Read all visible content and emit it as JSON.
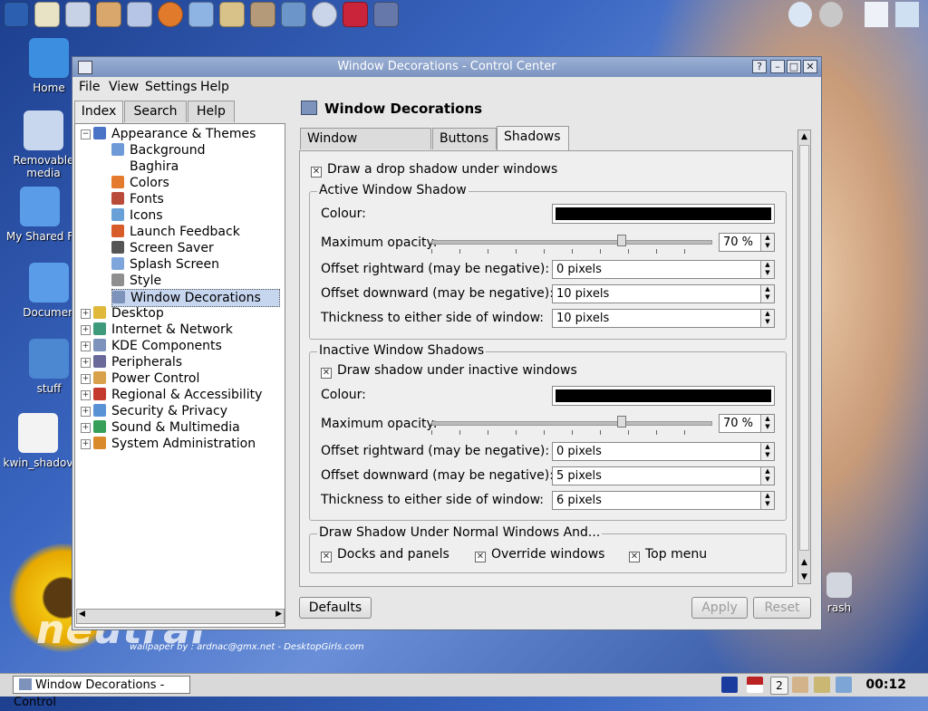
{
  "desktop": {
    "icons": [
      {
        "label": "Home"
      },
      {
        "label": "Removable media"
      },
      {
        "label": "My Shared F"
      },
      {
        "label": "Documen"
      },
      {
        "label": "stuff"
      },
      {
        "label": "kwin_shadov"
      },
      {
        "label": "rash"
      }
    ],
    "wallpaper_credit": "wallpaper by : ardnac@gmx.net - DesktopGirls.com"
  },
  "window": {
    "title": "Window Decorations - Control Center",
    "buttons": {
      "help": "?",
      "minimize": "–",
      "maximize": "□",
      "close": "✕"
    },
    "menu": [
      "File",
      "View",
      "Settings",
      "Help"
    ]
  },
  "sidebar": {
    "tabs": [
      "Index",
      "Search",
      "Help"
    ],
    "tree": [
      {
        "label": "Appearance & Themes",
        "icon": "appearance-icon",
        "expanded": true
      },
      {
        "label": "Background",
        "icon": "background-icon"
      },
      {
        "label": "Baghira",
        "icon": ""
      },
      {
        "label": "Colors",
        "icon": "colors-icon"
      },
      {
        "label": "Fonts",
        "icon": "fonts-icon"
      },
      {
        "label": "Icons",
        "icon": "icons-icon"
      },
      {
        "label": "Launch Feedback",
        "icon": "launch-feedback-icon"
      },
      {
        "label": "Screen Saver",
        "icon": "screen-saver-icon"
      },
      {
        "label": "Splash Screen",
        "icon": "splash-screen-icon"
      },
      {
        "label": "Style",
        "icon": "style-icon"
      },
      {
        "label": "Window Decorations",
        "icon": "window-decorations-icon",
        "selected": true
      },
      {
        "label": "Desktop",
        "icon": "desktop-icon"
      },
      {
        "label": "Internet & Network",
        "icon": "internet-icon"
      },
      {
        "label": "KDE Components",
        "icon": "kde-components-icon"
      },
      {
        "label": "Peripherals",
        "icon": "peripherals-icon"
      },
      {
        "label": "Power Control",
        "icon": "power-control-icon"
      },
      {
        "label": "Regional & Accessibility",
        "icon": "regional-icon"
      },
      {
        "label": "Security & Privacy",
        "icon": "security-icon"
      },
      {
        "label": "Sound & Multimedia",
        "icon": "sound-icon"
      },
      {
        "label": "System Administration",
        "icon": "system-admin-icon"
      }
    ]
  },
  "content": {
    "title": "Window Decorations",
    "tabs": [
      "Window Decoration",
      "Buttons",
      "Shadows"
    ],
    "active_tab": "Shadows",
    "drop_shadow_label": "Draw a drop shadow under windows",
    "active": {
      "title": "Active Window Shadow",
      "colour_label": "Colour:",
      "colour": "#000000",
      "opacity_label": "Maximum opacity:",
      "opacity": "70 %",
      "opacity_value": 0.7,
      "offset_right_label": "Offset rightward (may be negative):",
      "offset_right": "0 pixels",
      "offset_down_label": "Offset downward (may be negative):",
      "offset_down": "10 pixels",
      "thickness_label": "Thickness to either side of window:",
      "thickness": "10 pixels"
    },
    "inactive": {
      "title": "Inactive Window Shadows",
      "draw_label": "Draw shadow under inactive windows",
      "colour_label": "Colour:",
      "colour": "#000000",
      "opacity_label": "Maximum opacity:",
      "opacity": "70 %",
      "opacity_value": 0.7,
      "offset_right_label": "Offset rightward (may be negative):",
      "offset_right": "0 pixels",
      "offset_down_label": "Offset downward (may be negative):",
      "offset_down": "5 pixels",
      "thickness_label": "Thickness to either side of window:",
      "thickness": "6 pixels"
    },
    "normal": {
      "title": "Draw Shadow Under Normal Windows And...",
      "docks": "Docks and panels",
      "override": "Override windows",
      "topmenu": "Top menu"
    },
    "buttons": {
      "defaults": "Defaults",
      "apply": "Apply",
      "reset": "Reset"
    }
  },
  "taskbar": {
    "task_label": "Window Decorations - Control",
    "desktop_number": "2",
    "clock": "00:12"
  }
}
